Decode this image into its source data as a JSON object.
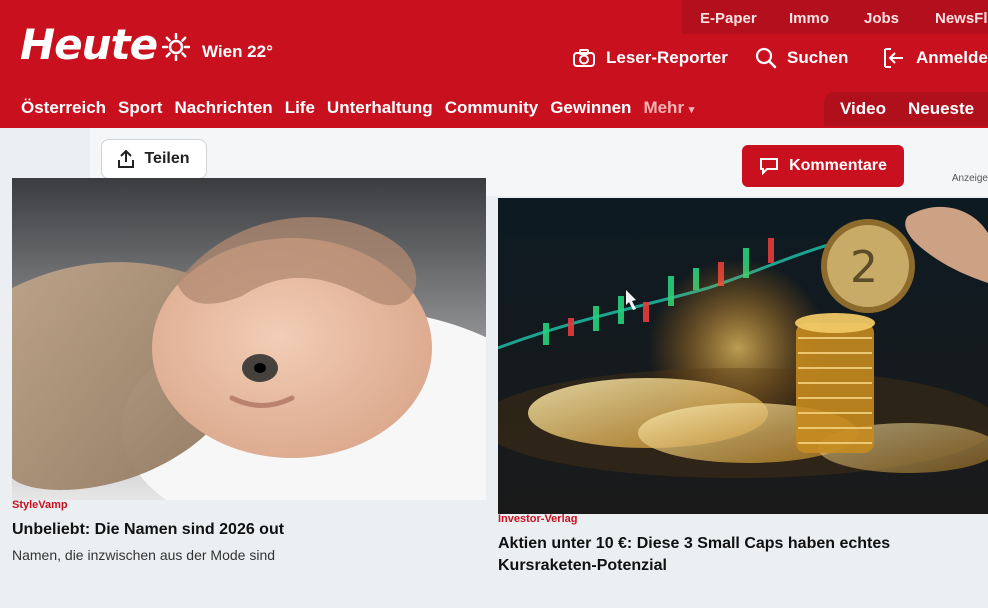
{
  "top_links": [
    "E-Paper",
    "Immo",
    "Jobs",
    "NewsFlix"
  ],
  "brand": {
    "logo": "Heute",
    "weather_icon": "sun-icon",
    "weather_text": "Wien 22°"
  },
  "header_actions": {
    "reporter": {
      "icon": "camera-icon",
      "label": "Leser-Reporter"
    },
    "search": {
      "icon": "search-icon",
      "label": "Suchen"
    },
    "login": {
      "icon": "login-icon",
      "label": "Anmelden"
    }
  },
  "nav": {
    "items": [
      "Österreich",
      "Sport",
      "Nachrichten",
      "Life",
      "Unterhaltung",
      "Community",
      "Gewinnen"
    ],
    "more_label": "Mehr",
    "right_items": [
      "Video",
      "Neueste"
    ]
  },
  "actions": {
    "share": {
      "icon": "share-icon",
      "label": "Teilen"
    },
    "comments": {
      "icon": "comment-icon",
      "label": "Kommentare"
    },
    "ad_label": "Anzeige"
  },
  "cards": [
    {
      "sponsor": "StyleVamp",
      "headline": "Unbeliebt: Die Namen sind 2026 out",
      "subline": "Namen, die inzwischen aus der Mode sind"
    },
    {
      "sponsor": "Investor-Verlag",
      "headline_line1": "Aktien unter 10 €: Diese 3 Small Caps haben echtes",
      "headline_line2": "Kursraketen-Potenzial"
    }
  ],
  "colors": {
    "brand_red": "#c8101f"
  }
}
